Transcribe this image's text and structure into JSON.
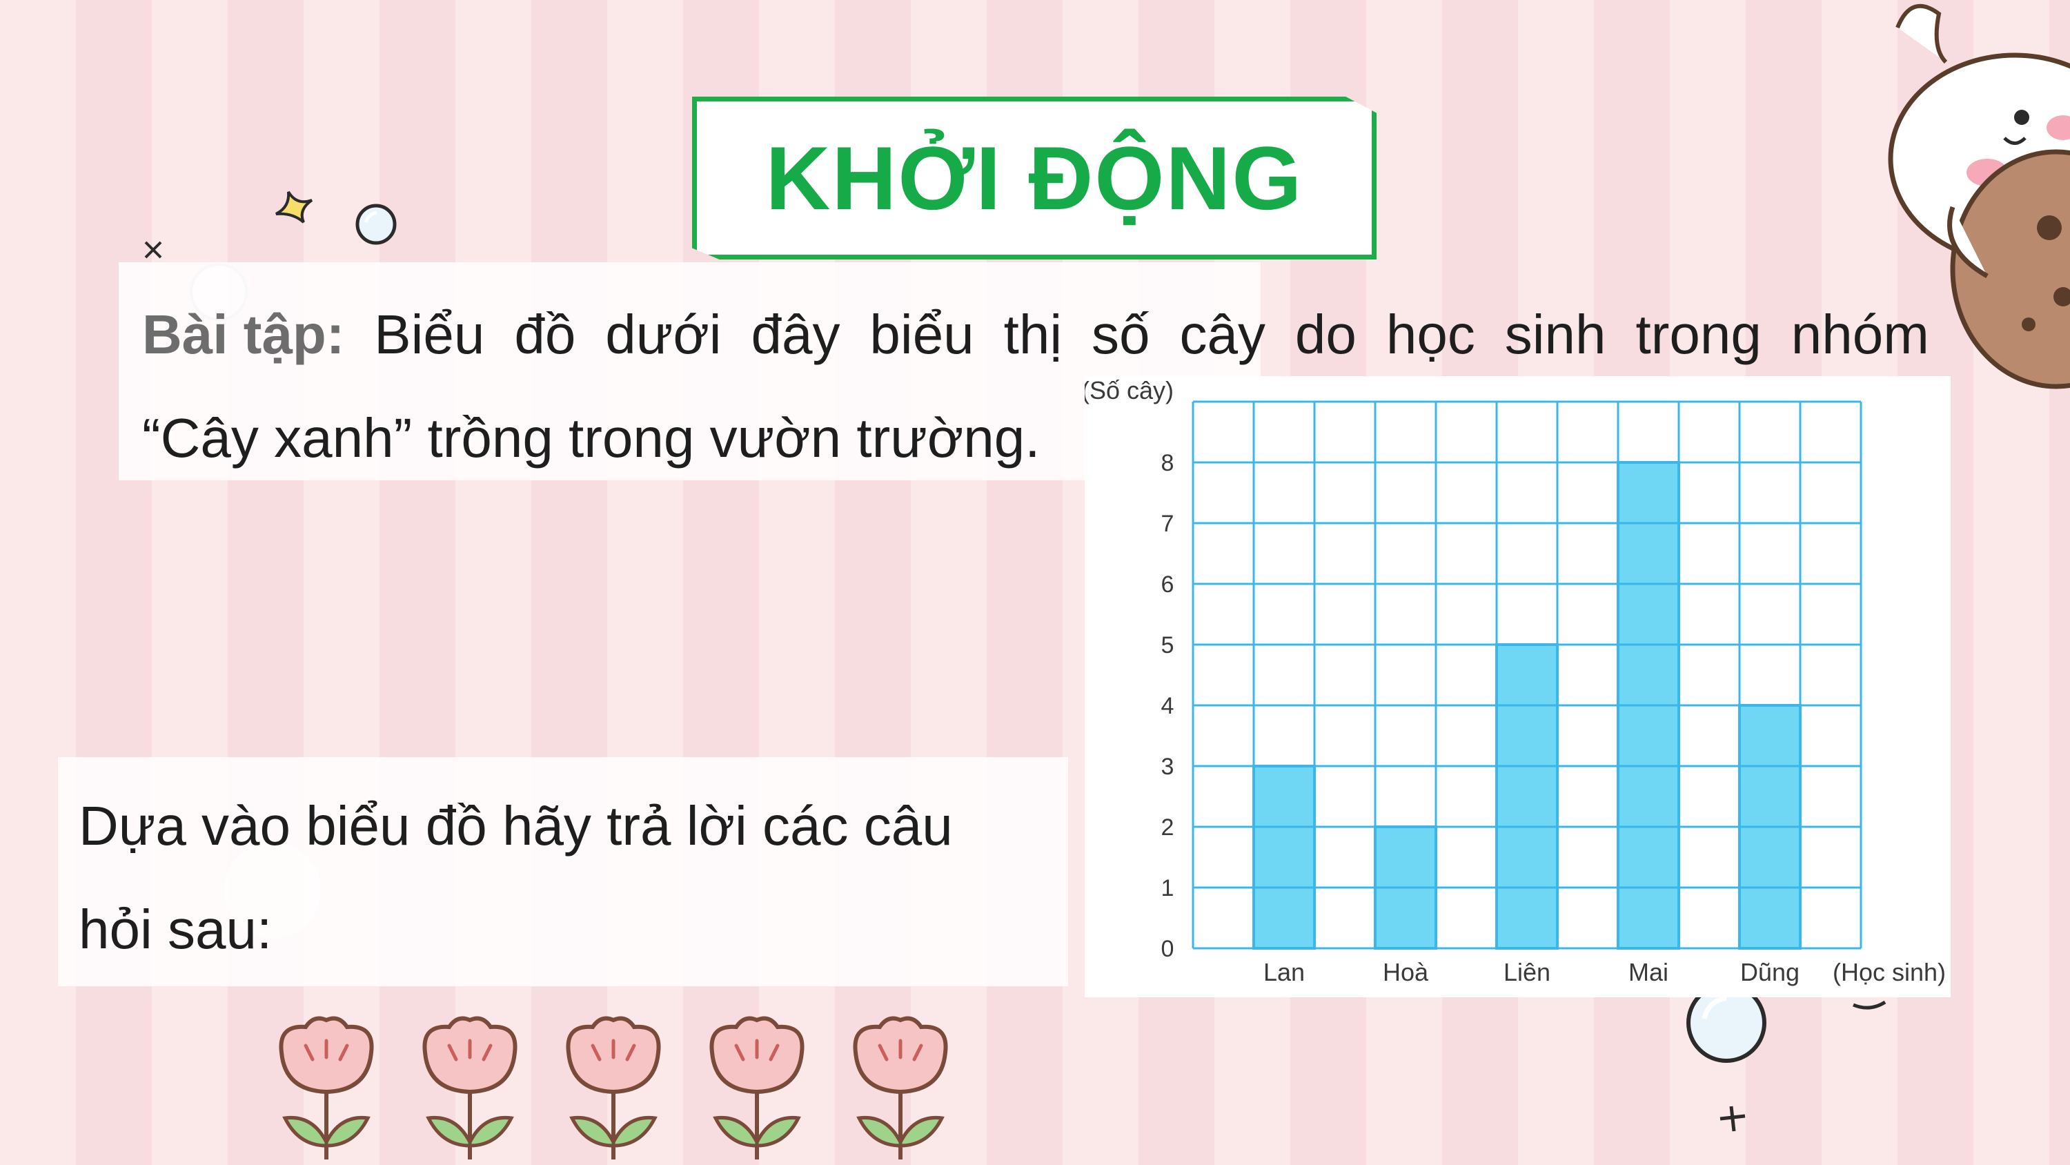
{
  "header": {
    "title": "KHỞI ĐỘNG"
  },
  "exercise": {
    "label": "Bài tập:",
    "line1_words": [
      "Biểu",
      "đồ",
      "dưới",
      "đây",
      "biểu",
      "thị",
      "số",
      "cây",
      "do",
      "học",
      "sinh",
      "trong",
      "nhóm"
    ],
    "line2": "“Cây xanh” trồng trong vườn trường."
  },
  "prompt": {
    "line1": "Dựa vào biểu đồ hãy trả lời các câu",
    "line2": "hỏi sau:"
  },
  "chart_data": {
    "type": "bar",
    "categories": [
      "Lan",
      "Hoà",
      "Liên",
      "Mai",
      "Dũng"
    ],
    "values": [
      3,
      2,
      5,
      8,
      4
    ],
    "title": "",
    "xlabel": "(Học sinh)",
    "ylabel": "(Số cây)",
    "ylim": [
      0,
      9
    ],
    "yticks": [
      0,
      1,
      2,
      3,
      4,
      5,
      6,
      7,
      8
    ],
    "grid": true,
    "bar_color": "#6fd6f3",
    "grid_color": "#3ab7e8"
  },
  "colors": {
    "title_green": "#16ab48",
    "background_pink": "#fbe9ea"
  }
}
